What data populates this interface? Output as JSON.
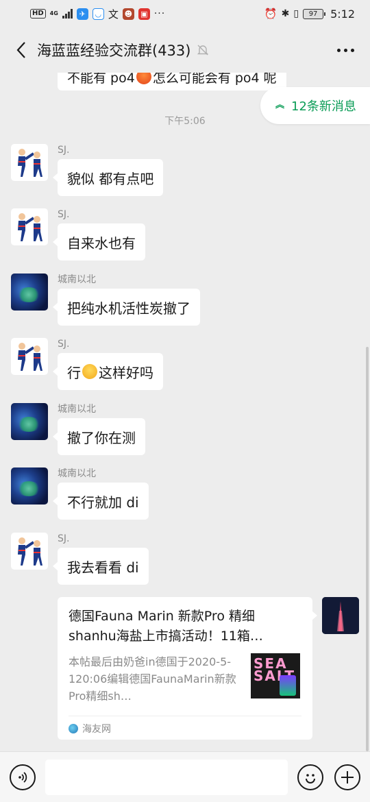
{
  "status_bar": {
    "hd": "HD",
    "network": "4G",
    "app_icon_text": "文",
    "more": "···",
    "battery": "97",
    "time": "5:12"
  },
  "header": {
    "title": "海蓝蓝经验交流群(433)"
  },
  "chat": {
    "partial_message": {
      "before": "不能有 po4",
      "after": "怎么可能会有 po4 呢"
    },
    "new_messages_pill": "12条新消息",
    "timestamp": "下午5:06",
    "messages": [
      {
        "sender": "SJ.",
        "avatar": "sj",
        "text": "貌似 都有点吧"
      },
      {
        "sender": "SJ.",
        "avatar": "sj",
        "text": "自来水也有"
      },
      {
        "sender": "城南以北",
        "avatar": "chengnan",
        "text": "把纯水机活性炭撤了"
      },
      {
        "sender": "SJ.",
        "avatar": "sj",
        "text_before": "行",
        "text_after": "这样好吗"
      },
      {
        "sender": "城南以北",
        "avatar": "chengnan",
        "text": "撤了你在测"
      },
      {
        "sender": "城南以北",
        "avatar": "chengnan",
        "text": "不行就加 di"
      },
      {
        "sender": "SJ.",
        "avatar": "sj",
        "text": "我去看看 di"
      }
    ],
    "link_card": {
      "title": "德国Fauna Marin 新款Pro 精细shanhu海盐上市搞活动！11箱…",
      "description": "本帖最后由奶爸in德国于2020-5-120:06编辑德国FaunaMarin新款Pro精细sh…",
      "thumb_text": "SEA SALT",
      "source": "海友网"
    }
  },
  "input": {
    "placeholder": ""
  }
}
